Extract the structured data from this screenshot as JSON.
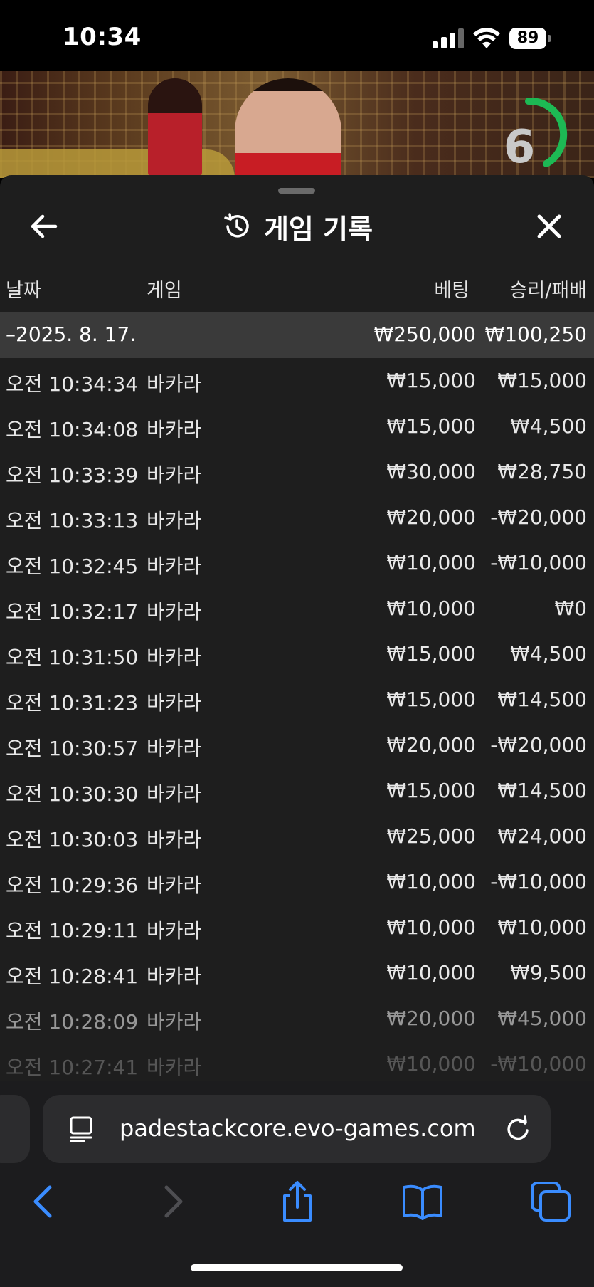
{
  "status_bar": {
    "time": "10:34",
    "battery": "89"
  },
  "video": {
    "countdown": "6",
    "timer_color": "#1db954"
  },
  "panel": {
    "title": "게임 기록",
    "columns": {
      "date": "날짜",
      "game": "게임",
      "bet": "베팅",
      "result": "승리/패배"
    },
    "summary": {
      "date": "–2025. 8. 17.",
      "bet": "₩250,000",
      "result": "₩100,250"
    },
    "rows": [
      {
        "time": "오전 10:34:34",
        "game": "바카라",
        "bet": "₩15,000",
        "result": "₩15,000"
      },
      {
        "time": "오전 10:34:08",
        "game": "바카라",
        "bet": "₩15,000",
        "result": "₩4,500"
      },
      {
        "time": "오전 10:33:39",
        "game": "바카라",
        "bet": "₩30,000",
        "result": "₩28,750"
      },
      {
        "time": "오전 10:33:13",
        "game": "바카라",
        "bet": "₩20,000",
        "result": "-₩20,000"
      },
      {
        "time": "오전 10:32:45",
        "game": "바카라",
        "bet": "₩10,000",
        "result": "-₩10,000"
      },
      {
        "time": "오전 10:32:17",
        "game": "바카라",
        "bet": "₩10,000",
        "result": "₩0"
      },
      {
        "time": "오전 10:31:50",
        "game": "바카라",
        "bet": "₩15,000",
        "result": "₩4,500"
      },
      {
        "time": "오전 10:31:23",
        "game": "바카라",
        "bet": "₩15,000",
        "result": "₩14,500"
      },
      {
        "time": "오전 10:30:57",
        "game": "바카라",
        "bet": "₩20,000",
        "result": "-₩20,000"
      },
      {
        "time": "오전 10:30:30",
        "game": "바카라",
        "bet": "₩15,000",
        "result": "₩14,500"
      },
      {
        "time": "오전 10:30:03",
        "game": "바카라",
        "bet": "₩25,000",
        "result": "₩24,000"
      },
      {
        "time": "오전 10:29:36",
        "game": "바카라",
        "bet": "₩10,000",
        "result": "-₩10,000"
      },
      {
        "time": "오전 10:29:11",
        "game": "바카라",
        "bet": "₩10,000",
        "result": "₩10,000"
      },
      {
        "time": "오전 10:28:41",
        "game": "바카라",
        "bet": "₩10,000",
        "result": "₩9,500"
      },
      {
        "time": "오전 10:28:09",
        "game": "바카라",
        "bet": "₩20,000",
        "result": "₩45,000"
      },
      {
        "time": "오전 10:27:41",
        "game": "바카라",
        "bet": "₩10,000",
        "result": "-₩10,000"
      }
    ]
  },
  "browser": {
    "url": "padestackcore.evo-games.com",
    "accent_color": "#3a8cff"
  },
  "icons": [
    "back-arrow-icon",
    "history-icon",
    "close-icon",
    "reader-icon",
    "reload-icon",
    "back-chevron-icon",
    "forward-chevron-icon",
    "share-icon",
    "bookmarks-icon",
    "tabs-icon"
  ]
}
